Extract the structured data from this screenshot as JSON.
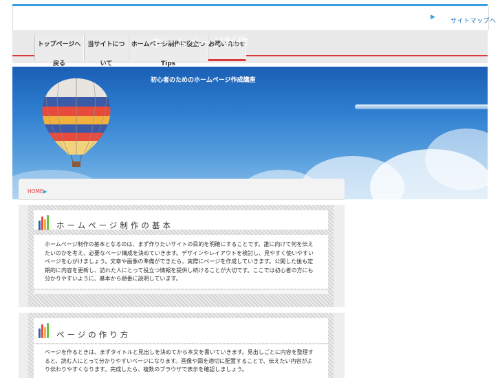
{
  "header": {
    "top_link": "サイトマップへ"
  },
  "nav": {
    "items": [
      {
        "label": "トップページへ戻る"
      },
      {
        "label": "当サイトについて"
      },
      {
        "label": "ホームページ制作に役立つTips"
      },
      {
        "label": "お問い合わせ"
      }
    ]
  },
  "hero": {
    "title": "ホームページ制作",
    "subtitle": "初心者のためのホームページ作成講座"
  },
  "breadcrumb": {
    "home": "HOME"
  },
  "sections": [
    {
      "title": "ホームページ制作の基本",
      "body": "ホームページ制作の基本となるのは、まず作りたいサイトの目的を明確にすることです。誰に向けて何を伝えたいのかを考え、必要なページ構成を決めていきます。デザインやレイアウトを検討し、見やすく使いやすいページを心がけましょう。文章や画像の準備ができたら、実際にページを作成していきます。公開した後も定期的に内容を更新し、訪れた人にとって役立つ情報を提供し続けることが大切です。ここでは初心者の方にも分かりやすいように、基本から順番に説明しています。"
    },
    {
      "title": "ページの作り方",
      "body": "ページを作るときは、まずタイトルと見出しを決めてから本文を書いていきます。見出しごとに内容を整理すると、読む人にとって分かりやすいページになります。画像や図を適切に配置することで、伝えたい内容がより伝わりやすくなります。完成したら、複数のブラウザで表示を確認しましょう。"
    }
  ],
  "colors": {
    "accent_blue": "#3a9fe0",
    "accent_red": "#d83a3a"
  }
}
